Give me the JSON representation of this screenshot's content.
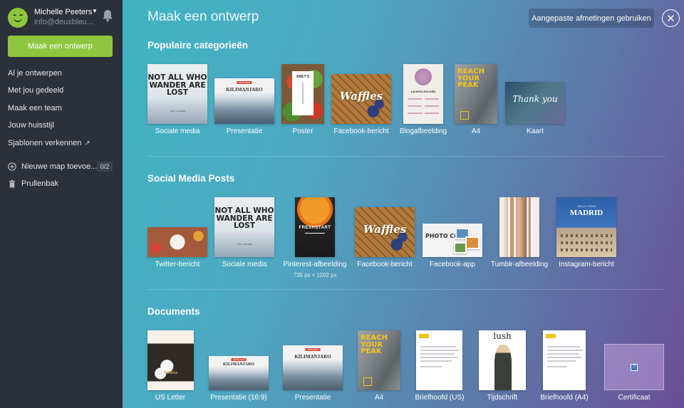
{
  "user": {
    "name": "Michelle Peeters",
    "email": "info@deuxbleu..."
  },
  "sidebar": {
    "create_button": "Maak een ontwerp",
    "items": [
      "Al je ontwerpen",
      "Met jou gedeeld",
      "Maak een team",
      "Jouw huisstijl",
      "Sjablonen verkennen"
    ],
    "new_folder": "Nieuwe map toevoe...",
    "folder_count": "0/2",
    "trash": "Prullenbak"
  },
  "header": {
    "title": "Maak een ontwerp",
    "custom_size_button": "Aangepaste afmetingen gebruiken"
  },
  "sections": {
    "popular": {
      "title": "Populaire categorieën",
      "items": [
        "Sociale media",
        "Presentatie",
        "Poster",
        "Facebook-bericht",
        "Blogafbeelding",
        "A4",
        "Kaart"
      ]
    },
    "social": {
      "title": "Social Media Posts",
      "items": [
        "Twitter-bericht",
        "Sociale media",
        "Pinterest-afbeelding",
        "Facebook-bericht",
        "Facebook-app",
        "Tumblr-afbeelding",
        "Instagram-bericht"
      ],
      "pinterest_size": "735 px × 1102 px"
    },
    "documents": {
      "title": "Documents",
      "items": [
        "US Letter",
        "Presentatie (16:9)",
        "Presentatie",
        "A4",
        "Briefhoofd (US)",
        "Tijdschrift",
        "Briefhoofd (A4)",
        "Certificaat"
      ]
    }
  },
  "thumb_text": {
    "quote": "NOT ALL WHO WANDER ARE LOST",
    "quote_author": "J.R.R. TOLKIEN",
    "kilimanjaro": "KILIMANJARO",
    "date_tag": "05.05.2016",
    "poster_title": "ABEY'S",
    "waffles": "Waffles",
    "blog_name": "LAURYN HOLDEN",
    "reach": "REACH YOUR PEAK",
    "thank_you": "Thank you",
    "freshstart": "FRESHSTART",
    "photo_comp": "PHOTO COMP",
    "hello_from": "HELLO FROM",
    "madrid": "MADRID",
    "yafana": "Yafana",
    "lush": "lush"
  },
  "icons": {
    "bell": "bell-icon",
    "close": "close-icon",
    "plus": "plus-circle-icon",
    "trash": "trash-icon",
    "external": "external-link-icon",
    "caret": "caret-down-icon"
  },
  "colors": {
    "brand_green": "#8fc640",
    "sidebar_bg": "#2c3038"
  }
}
